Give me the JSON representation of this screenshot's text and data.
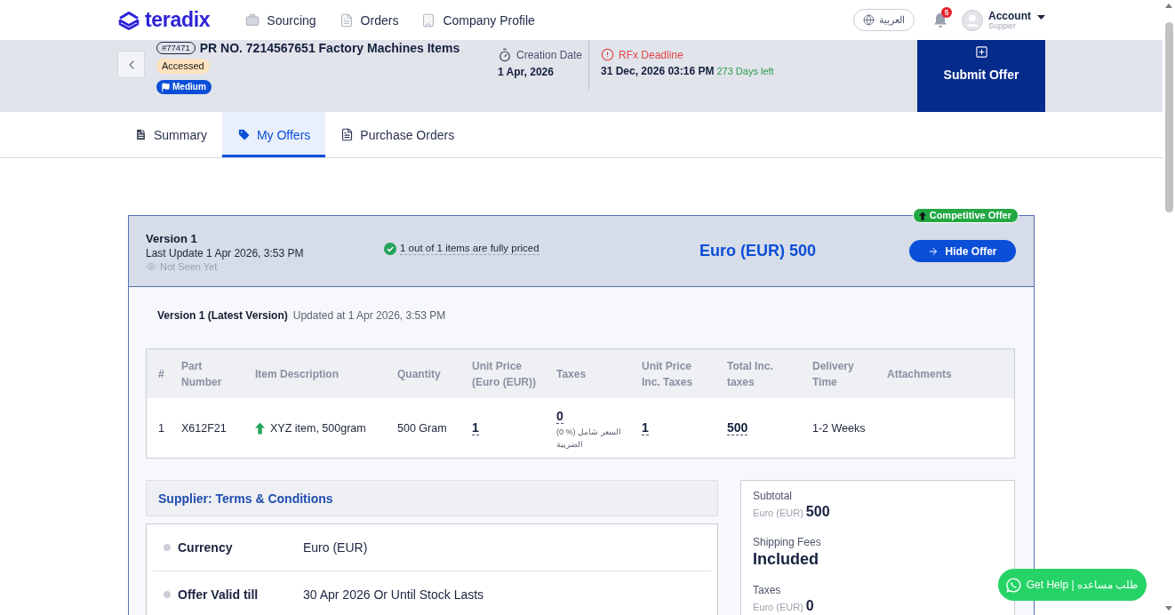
{
  "nav": {
    "logo": "teradix",
    "items": [
      {
        "label": "Sourcing"
      },
      {
        "label": "Orders"
      },
      {
        "label": "Company Profile"
      }
    ],
    "language": "العربية",
    "notifications": "5",
    "account": {
      "name": "Account",
      "role": "Suppier"
    }
  },
  "request": {
    "number": "#77471",
    "title": "PR NO. 7214567651 Factory Machines Items",
    "status": "Accessed",
    "priority": "Medium",
    "creation_date": {
      "label": "Creation Date",
      "value": "1 Apr, 2026"
    },
    "deadline": {
      "label": "RFx Deadline",
      "value": "31 Dec, 2026 03:16 PM",
      "remaining": "273 Days left"
    },
    "submit": "Submit Offer"
  },
  "tabs": [
    {
      "label": "Summary",
      "selected": false
    },
    {
      "label": "My Offers",
      "selected": true
    },
    {
      "label": "Purchase Orders",
      "selected": false
    }
  ],
  "offer": {
    "badge": "Competitive Offer",
    "version": "Version 1",
    "last_update": "Last Update 1 Apr 2026, 3:53 PM",
    "seen_status": "Not Seen Yet",
    "pricing_status": "1 out of 1 items are fully priced",
    "total": "Euro (EUR) 500",
    "hide_button": "Hide Offer",
    "version_title": "Version 1 (Latest Version)",
    "updated": "Updated at 1 Apr 2026, 3:53 PM"
  },
  "table": {
    "columns": [
      "#",
      "Part Number",
      "Item Description",
      "Quantity",
      "Unit Price (Euro (EUR))",
      "Taxes",
      "Unit Price Inc. Taxes",
      "Total Inc. taxes",
      "Delivery Time",
      "Attachments"
    ],
    "rows": [
      {
        "index": "1",
        "part_number": "X612F21",
        "description": "XYZ item, 500gram",
        "quantity": "500 Gram",
        "unit_price": "1",
        "taxes": {
          "amount": "0",
          "note": "(0 %) السعر شامل الضريبة"
        },
        "unit_price_inc_taxes": "1",
        "total": "500",
        "delivery_time": "1-2 Weeks"
      }
    ]
  },
  "terms": {
    "title": "Supplier: Terms & Conditions",
    "rows": [
      {
        "label": "Currency",
        "value": "Euro (EUR)"
      },
      {
        "label": "Offer Valid till",
        "value": "30 Apr 2026 Or Until Stock Lasts"
      }
    ]
  },
  "summary": [
    {
      "kind": "amount",
      "label": "Subtotal",
      "currency": "Euro (EUR)",
      "value": "500"
    },
    {
      "kind": "text",
      "label": "Shipping Fees",
      "value": "Included"
    },
    {
      "kind": "amount",
      "label": "Taxes",
      "currency": "Euro (EUR)",
      "value": "0"
    }
  ],
  "help_button": "Get Help | طلب مساعده"
}
